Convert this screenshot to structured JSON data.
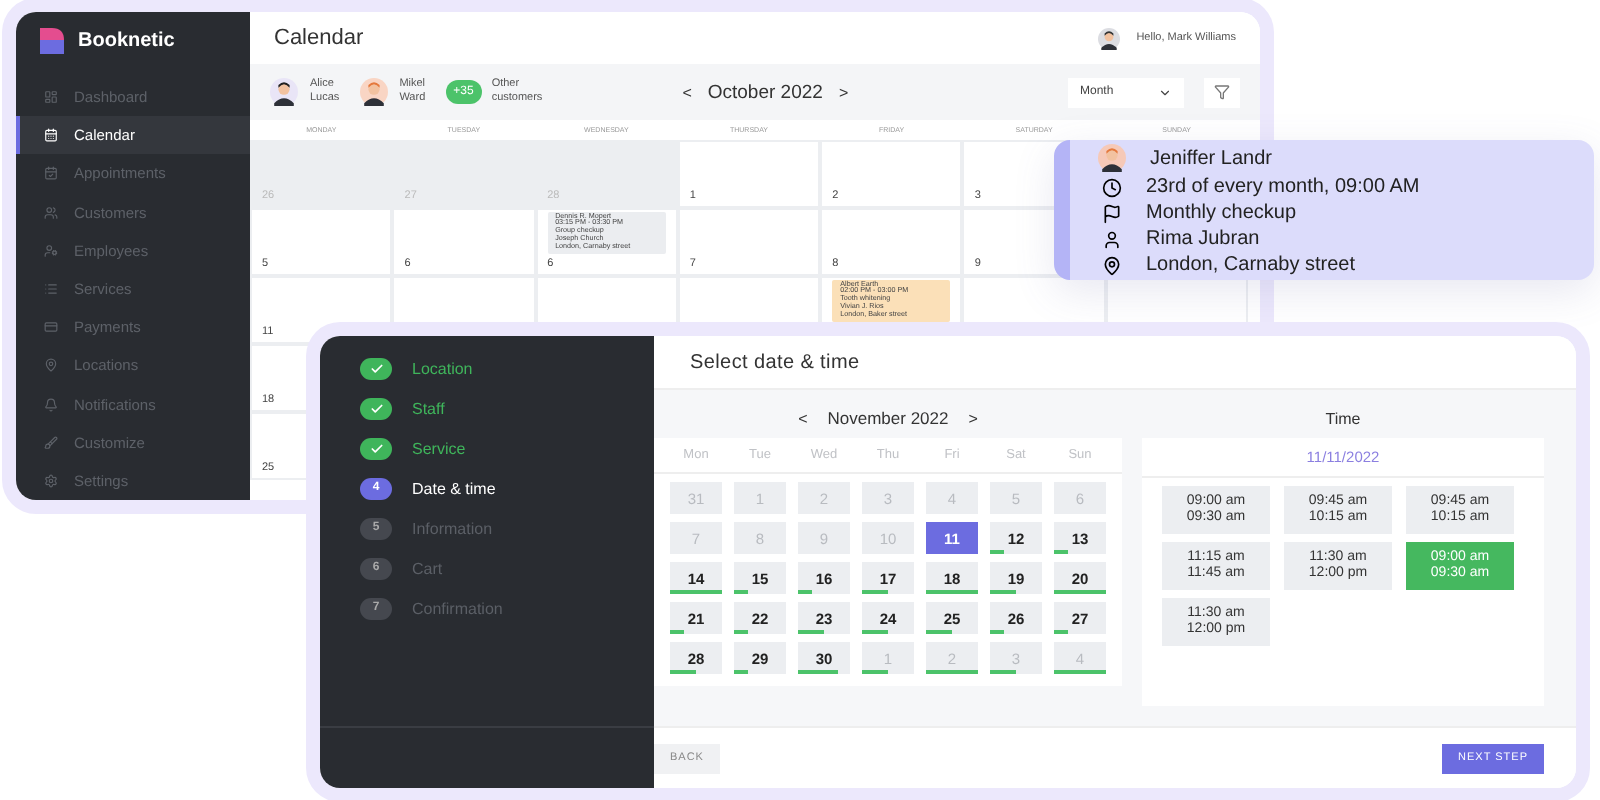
{
  "admin": {
    "brand": "Booknetic",
    "nav": [
      {
        "label": "Dashboard",
        "selected": false
      },
      {
        "label": "Calendar",
        "selected": true
      },
      {
        "label": "Appointments",
        "selected": false
      },
      {
        "label": "Customers",
        "selected": false
      },
      {
        "label": "Employees",
        "selected": false
      },
      {
        "label": "Services",
        "selected": false
      },
      {
        "label": "Payments",
        "selected": false
      },
      {
        "label": "Locations",
        "selected": false
      },
      {
        "label": "Notifications",
        "selected": false
      },
      {
        "label": "Customize",
        "selected": false
      },
      {
        "label": "Settings",
        "selected": false
      }
    ],
    "title": "Calendar",
    "greeting": "Hello, Mark Williams",
    "staff": [
      {
        "first": "Alice",
        "last": "Lucas"
      },
      {
        "first": "Mikel",
        "last": "Ward"
      }
    ],
    "others": {
      "count": "+35",
      "label_1": "Other",
      "label_2": "customers"
    },
    "month": "October 2022",
    "view": "Month",
    "weekdays": [
      "MONDAY",
      "TUESDAY",
      "WEDNESDAY",
      "THURSDAY",
      "FRIDAY",
      "SATURDAY",
      "SUNDAY"
    ],
    "rows": [
      {
        "cells": [
          {
            "day": "26",
            "muted": true
          },
          {
            "day": "27",
            "muted": true
          },
          {
            "day": "28",
            "muted": true
          },
          {
            "day": "1",
            "muted": false
          },
          {
            "day": "2",
            "muted": false
          },
          {
            "day": "3",
            "muted": false
          }
        ]
      },
      {
        "cells": [
          {
            "day": "5",
            "muted": false
          },
          {
            "day": "6",
            "muted": false
          },
          {
            "day": "6",
            "muted": false,
            "event": {
              "color": "#ebedf0",
              "lines": [
                "Dennis R. Mopert",
                "03:15 PM - 03:30 PM",
                "Group checkup",
                "Joseph Church",
                "London, Carnaby street"
              ]
            }
          },
          {
            "day": "7",
            "muted": false
          },
          {
            "day": "8",
            "muted": false
          },
          {
            "day": "9",
            "muted": false
          }
        ]
      },
      {
        "cells": [
          {
            "day": "11",
            "muted": false
          },
          {
            "muted": false
          },
          {
            "muted": false
          },
          {
            "muted": false
          },
          {
            "muted": false,
            "event": {
              "color": "#fbe0b8",
              "lines": [
                "Albert Earth",
                "02:00 PM - 03:00 PM",
                "Tooth whitening",
                "Vivian J. Rios",
                "London, Baker street"
              ]
            }
          }
        ]
      },
      {
        "cells": [
          {
            "day": "18",
            "muted": false
          }
        ]
      },
      {
        "cells": [
          {
            "day": "25",
            "muted": false
          }
        ]
      }
    ]
  },
  "popover": {
    "name": "Jeniffer Landr",
    "details": [
      "23rd of every month, 09:00 AM",
      "Monthly checkup",
      "Rima Jubran",
      "London, Carnaby street"
    ]
  },
  "booking": {
    "steps": [
      {
        "label": "Location",
        "kind": "done"
      },
      {
        "label": "Staff",
        "kind": "done"
      },
      {
        "label": "Service",
        "kind": "done"
      },
      {
        "number": "4",
        "label": "Date & time",
        "kind": "current"
      },
      {
        "number": "5",
        "label": "Information",
        "kind": "pending"
      },
      {
        "number": "6",
        "label": "Cart",
        "kind": "pending"
      },
      {
        "number": "7",
        "label": "Confirmation",
        "kind": "pending"
      }
    ],
    "title": "Select date & time",
    "month": "November 2022",
    "prev": "<",
    "next": ">",
    "weekdays": [
      "Mon",
      "Tue",
      "Wed",
      "Thu",
      "Fri",
      "Sat",
      "Sun"
    ],
    "days": [
      {
        "day": "31",
        "disabled": true,
        "selected": false
      },
      {
        "day": "1",
        "disabled": true,
        "selected": false
      },
      {
        "day": "2",
        "disabled": true,
        "selected": false
      },
      {
        "day": "3",
        "disabled": true,
        "selected": false
      },
      {
        "day": "4",
        "disabled": true,
        "selected": false
      },
      {
        "day": "5",
        "disabled": true,
        "selected": false
      },
      {
        "day": "6",
        "disabled": true,
        "selected": false
      },
      {
        "day": "7",
        "disabled": true,
        "selected": false
      },
      {
        "day": "8",
        "disabled": true,
        "selected": false
      },
      {
        "day": "9",
        "disabled": true,
        "selected": false
      },
      {
        "day": "10",
        "disabled": true,
        "selected": false
      },
      {
        "day": "11",
        "disabled": false,
        "selected": true
      },
      {
        "day": "12",
        "disabled": false,
        "selected": false,
        "level": 0.25
      },
      {
        "day": "13",
        "disabled": false,
        "selected": false,
        "level": 0.25
      },
      {
        "day": "14",
        "disabled": false,
        "selected": false,
        "level": 1
      },
      {
        "day": "15",
        "disabled": false,
        "selected": false,
        "level": 0.25
      },
      {
        "day": "16",
        "disabled": false,
        "selected": false,
        "level": 0.25
      },
      {
        "day": "17",
        "disabled": false,
        "selected": false,
        "level": 0.5
      },
      {
        "day": "18",
        "disabled": false,
        "selected": false,
        "level": 1
      },
      {
        "day": "19",
        "disabled": false,
        "selected": false,
        "level": 0.5
      },
      {
        "day": "20",
        "disabled": false,
        "selected": false,
        "level": 1
      },
      {
        "day": "21",
        "disabled": false,
        "selected": false,
        "level": 0.25
      },
      {
        "day": "22",
        "disabled": false,
        "selected": false,
        "level": 0.25
      },
      {
        "day": "23",
        "disabled": false,
        "selected": false,
        "level": 0.5
      },
      {
        "day": "24",
        "disabled": false,
        "selected": false,
        "level": 0.5
      },
      {
        "day": "25",
        "disabled": false,
        "selected": false,
        "level": 0.5
      },
      {
        "day": "26",
        "disabled": false,
        "selected": false,
        "level": 0.25
      },
      {
        "day": "27",
        "disabled": false,
        "selected": false,
        "level": 0.25
      },
      {
        "day": "28",
        "disabled": false,
        "selected": false,
        "level": 0.5
      },
      {
        "day": "29",
        "disabled": false,
        "selected": false,
        "level": 0.25
      },
      {
        "day": "30",
        "disabled": false,
        "selected": false,
        "level": 0.75
      },
      {
        "day": "1",
        "disabled": true,
        "selected": false,
        "level": 0.5
      },
      {
        "day": "2",
        "disabled": true,
        "selected": false,
        "level": 1
      },
      {
        "day": "3",
        "disabled": true,
        "selected": false,
        "level": 0.5
      },
      {
        "day": "4",
        "disabled": true,
        "selected": false,
        "level": 1
      }
    ],
    "time_heading": "Time",
    "date": "11/11/2022",
    "slots": [
      {
        "start": "09:00 am",
        "end": "09:30 am",
        "selected": false
      },
      {
        "start": "09:45 am",
        "end": "10:15 am",
        "selected": false
      },
      {
        "start": "09:45 am",
        "end": "10:15 am",
        "selected": false
      },
      {
        "start": "11:15 am",
        "end": "11:45 am",
        "selected": false
      },
      {
        "start": "11:30 am",
        "end": "12:00 pm",
        "selected": false
      },
      {
        "start": "09:00 am",
        "end": "09:30 am",
        "selected": true
      },
      {
        "start": "11:30 am",
        "end": "12:00 pm",
        "selected": false
      }
    ],
    "back": "BACK",
    "next_step": "NEXT STEP"
  }
}
